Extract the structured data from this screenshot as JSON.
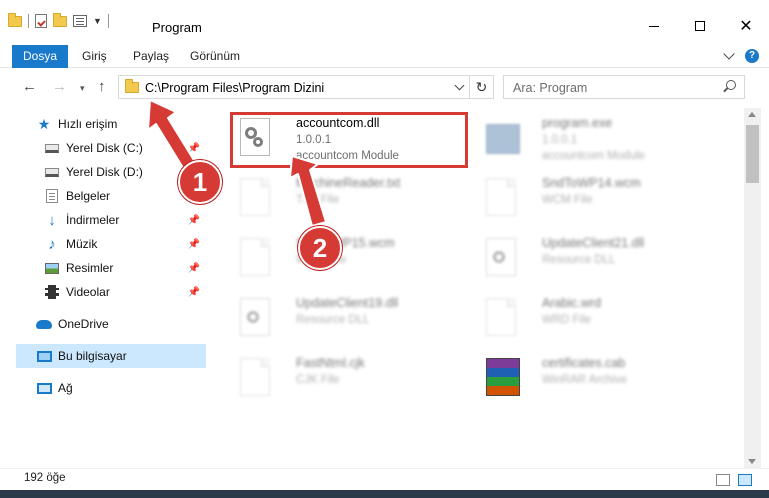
{
  "window": {
    "title": "Program",
    "minimize": "—",
    "close": "✕"
  },
  "ribbon": {
    "tabs": [
      "Dosya",
      "Giriş",
      "Paylaş",
      "Görünüm"
    ],
    "help": "?"
  },
  "address": {
    "path": "C:\\Program Files\\Program Dizini",
    "refresh": "↻"
  },
  "search": {
    "placeholder": "Ara: Program"
  },
  "nav": {
    "back": "←",
    "forward": "→",
    "recent": "▾",
    "up": "↑"
  },
  "sidebar": {
    "items": [
      {
        "label": "Hızlı erişim",
        "icon": "star-icon"
      },
      {
        "label": "Yerel Disk (C:)",
        "icon": "drive-icon",
        "pinned": true
      },
      {
        "label": "Yerel Disk (D:)",
        "icon": "drive-icon"
      },
      {
        "label": "Belgeler",
        "icon": "documents-icon",
        "pinned": true
      },
      {
        "label": "İndirmeler",
        "icon": "downloads-icon",
        "pinned": true
      },
      {
        "label": "Müzik",
        "icon": "music-icon",
        "pinned": true
      },
      {
        "label": "Resimler",
        "icon": "pictures-icon",
        "pinned": true
      },
      {
        "label": "Videolar",
        "icon": "videos-icon",
        "pinned": true
      },
      {
        "label": "OneDrive",
        "icon": "onedrive-icon"
      },
      {
        "label": "Bu bilgisayar",
        "icon": "computer-icon",
        "selected": true
      },
      {
        "label": "Ağ",
        "icon": "network-icon"
      }
    ]
  },
  "files": [
    {
      "name": "accountcom.dll",
      "line2": "1.0.0.1",
      "line3": "accountcom Module",
      "icon": "dll-file-icon"
    },
    {
      "name": "program.exe",
      "line2": "1.0.0.1",
      "line3": "accountcom Module",
      "icon": "exe-file-icon"
    },
    {
      "name": "MachineReader.txt",
      "line2": "TXT File",
      "line3": "",
      "icon": "text-file-icon"
    },
    {
      "name": "SndToWP14.wcm",
      "line2": "WCM File",
      "line3": "",
      "icon": "file-icon"
    },
    {
      "name": "SndToWP15.wcm",
      "line2": "WCM File",
      "line3": "",
      "icon": "file-icon"
    },
    {
      "name": "UpdateClient21.dll",
      "line2": "Resource DLL",
      "line3": "",
      "icon": "dll-file-icon"
    },
    {
      "name": "UpdateClient19.dll",
      "line2": "Resource DLL",
      "line3": "",
      "icon": "dll-file-icon"
    },
    {
      "name": "Arabic.wrd",
      "line2": "WRD File",
      "line3": "",
      "icon": "file-icon"
    },
    {
      "name": "FastNtml.cjk",
      "line2": "CJK File",
      "line3": "",
      "icon": "file-icon"
    },
    {
      "name": "certificates.cab",
      "line2": "WinRAR Archive",
      "line3": "",
      "icon": "rar-file-icon"
    }
  ],
  "status": {
    "count": "192 öğe"
  },
  "annotations": {
    "step1": "1",
    "step2": "2",
    "color": "#d63a35"
  }
}
